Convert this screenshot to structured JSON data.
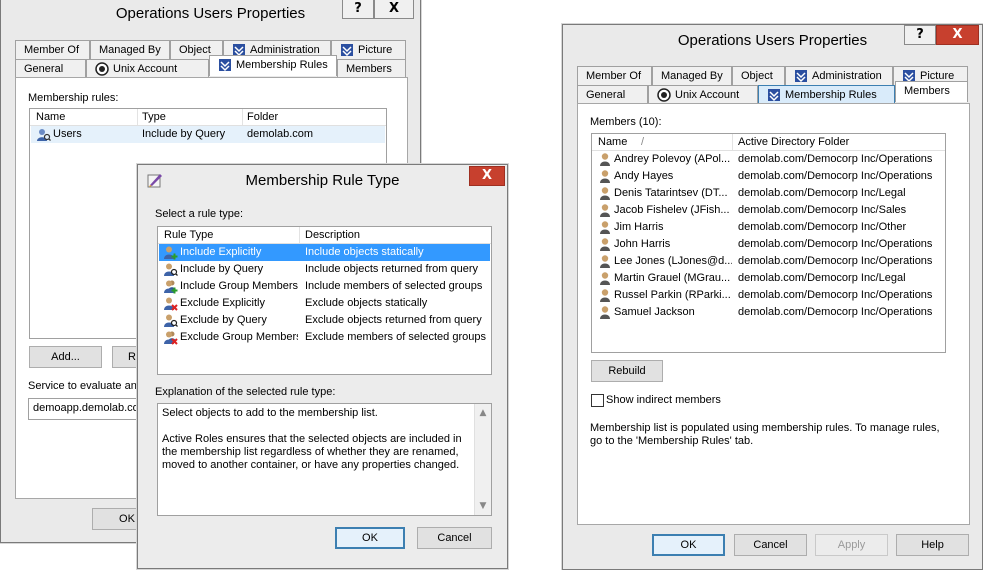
{
  "left_window": {
    "title": "Operations Users Properties",
    "help_btn": "?",
    "close_btn": "X",
    "tabs_row1": [
      "Member Of",
      "Managed By",
      "Object",
      "Administration",
      "Picture"
    ],
    "tabs_row2": [
      "General",
      "Unix Account",
      "Membership Rules",
      "Members"
    ],
    "rules_label": "Membership rules:",
    "rules_columns": [
      "Name",
      "Type",
      "Folder"
    ],
    "rules_rows": [
      {
        "name": "Users",
        "type": "Include by Query",
        "folder": "demolab.com"
      }
    ],
    "add_button": "Add...",
    "remove_button_partial": "Re",
    "service_label": "Service to evaluate and",
    "service_value": "demoapp.demolab.com",
    "ok_button": "OK"
  },
  "rule_dialog": {
    "title": "Membership Rule Type",
    "close_btn": "X",
    "select_label": "Select a rule type:",
    "columns": [
      "Rule Type",
      "Description"
    ],
    "rows": [
      {
        "type": "Include Explicitly",
        "description": "Include objects statically",
        "icon": "user-add-icon"
      },
      {
        "type": "Include by Query",
        "description": "Include objects returned from query",
        "icon": "user-query-icon"
      },
      {
        "type": "Include Group Members",
        "description": "Include members of selected groups",
        "icon": "group-add-icon"
      },
      {
        "type": "Exclude Explicitly",
        "description": "Exclude objects statically",
        "icon": "user-remove-icon"
      },
      {
        "type": "Exclude by Query",
        "description": "Exclude objects returned from query",
        "icon": "user-query-remove-icon"
      },
      {
        "type": "Exclude Group Members",
        "description": "Exclude members of selected groups",
        "icon": "group-remove-icon"
      }
    ],
    "selected_index": 0,
    "explanation_label": "Explanation of the selected rule type:",
    "explanation_line1": "Select objects to add to the membership list.",
    "explanation_line2": "Active Roles ensures that the selected objects are included in the membership list regardless of whether they are renamed, moved to another container, or have any properties changed.",
    "ok_button": "OK",
    "cancel_button": "Cancel"
  },
  "right_window": {
    "title": "Operations Users Properties",
    "help_btn": "?",
    "close_btn": "X",
    "tabs_row1": [
      "Member Of",
      "Managed By",
      "Object",
      "Administration",
      "Picture"
    ],
    "tabs_row2": [
      "General",
      "Unix Account",
      "Membership Rules",
      "Members"
    ],
    "members_label": "Members (10):",
    "columns": [
      "Name",
      "Active Directory Folder"
    ],
    "sort_indicator": "/",
    "members": [
      {
        "name": "Andrey Polevoy (APol...",
        "folder": "demolab.com/Democorp Inc/Operations"
      },
      {
        "name": "Andy Hayes",
        "folder": "demolab.com/Democorp Inc/Operations"
      },
      {
        "name": "Denis Tatarintsev (DT...",
        "folder": "demolab.com/Democorp Inc/Legal"
      },
      {
        "name": "Jacob Fishelev (JFish...",
        "folder": "demolab.com/Democorp Inc/Sales"
      },
      {
        "name": "Jim Harris",
        "folder": "demolab.com/Democorp Inc/Other"
      },
      {
        "name": "John Harris",
        "folder": "demolab.com/Democorp Inc/Operations"
      },
      {
        "name": "Lee Jones (LJones@d...",
        "folder": "demolab.com/Democorp Inc/Operations"
      },
      {
        "name": "Martin Grauel (MGrau...",
        "folder": "demolab.com/Democorp Inc/Legal"
      },
      {
        "name": "Russel Parkin (RParki...",
        "folder": "demolab.com/Democorp Inc/Operations"
      },
      {
        "name": "Samuel Jackson",
        "folder": "demolab.com/Democorp Inc/Operations"
      }
    ],
    "rebuild_button": "Rebuild",
    "show_indirect": "Show indirect members",
    "note": "Membership list is populated using membership rules. To manage rules, go to the 'Membership Rules' tab.",
    "ok_button": "OK",
    "cancel_button": "Cancel",
    "apply_button": "Apply",
    "help_button": "Help"
  }
}
